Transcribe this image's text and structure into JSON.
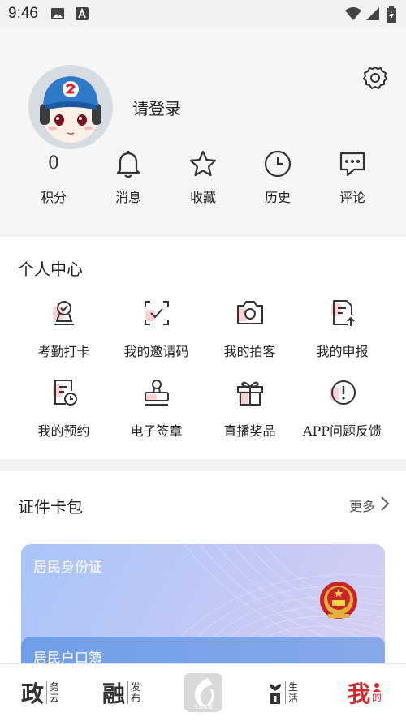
{
  "status_bar": {
    "time": "9:46"
  },
  "profile": {
    "login_text": "请登录"
  },
  "stats": [
    {
      "value": "0",
      "label": "积分",
      "icon": "points"
    },
    {
      "label": "消息",
      "icon": "bell-icon"
    },
    {
      "label": "收藏",
      "icon": "star-icon"
    },
    {
      "label": "历史",
      "icon": "clock-icon"
    },
    {
      "label": "评论",
      "icon": "comment-icon"
    }
  ],
  "personal_center": {
    "title": "个人中心",
    "items": [
      {
        "label": "考勤打卡",
        "icon": "checkin-icon"
      },
      {
        "label": "我的邀请码",
        "icon": "invite-code-icon"
      },
      {
        "label": "我的拍客",
        "icon": "camera-icon"
      },
      {
        "label": "我的申报",
        "icon": "report-icon"
      },
      {
        "label": "我的预约",
        "icon": "appointment-icon"
      },
      {
        "label": "电子签章",
        "icon": "seal-icon"
      },
      {
        "label": "直播奖品",
        "icon": "gift-icon"
      },
      {
        "label": "APP问题反馈",
        "icon": "feedback-icon"
      }
    ]
  },
  "wallet": {
    "title": "证件卡包",
    "more": "更多",
    "cards": [
      {
        "title": "居民身份证"
      },
      {
        "title": "居民户口簿"
      }
    ]
  },
  "tabbar": [
    {
      "big": "政",
      "small1": "务",
      "small2": "云",
      "active": false
    },
    {
      "big": "融",
      "small1": "发",
      "small2": "布",
      "active": false
    },
    {
      "center_logo": "今日蕉城",
      "active": false
    },
    {
      "big": "i",
      "small1": "生",
      "small2": "活",
      "active": false
    },
    {
      "big": "我",
      "small1": "的",
      "active": true
    }
  ],
  "colors": {
    "accent": "#d9252a",
    "pink_highlight": "#f9d3d4"
  }
}
